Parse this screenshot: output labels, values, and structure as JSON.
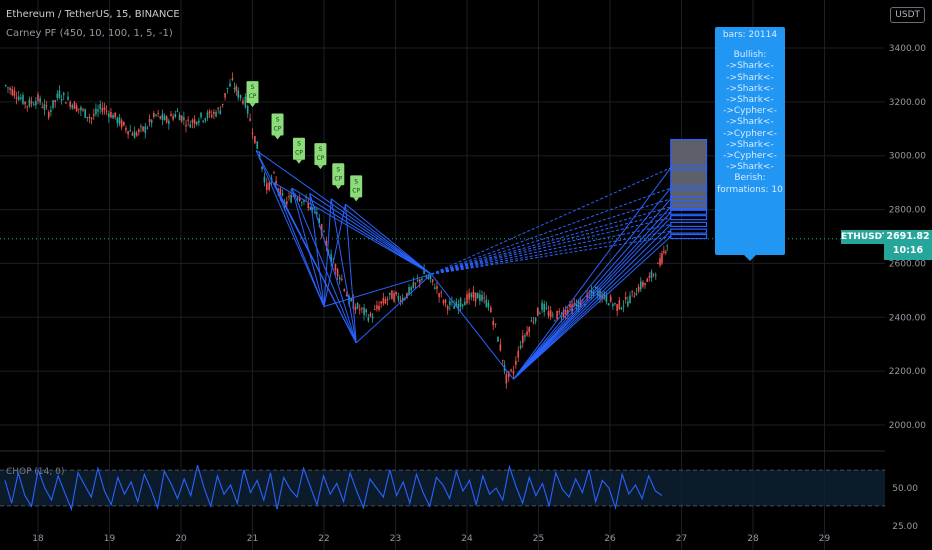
{
  "header": {
    "title": "Ethereum / TetherUS, 15, BINANCE",
    "indicator": "Carney PF (450, 10, 100, 1, 5, -1)",
    "currency": "USDT"
  },
  "colors": {
    "background": "#000000",
    "pattern_lines": "#2962ff",
    "candle_up": "#26a69a",
    "candle_down": "#ef5350",
    "info_box": "#2196f3",
    "price_badge": "#26a69a",
    "signal_label": "#8bdc7a"
  },
  "info_box": {
    "bars": "bars: 20114",
    "lines": [
      "Bullish:",
      "->Shark<-",
      "->Shark<-",
      "->Shark<-",
      "->Shark<-",
      "->Cypher<-",
      "->Shark<-",
      "->Cypher<-",
      "->Shark<-",
      "->Cypher<-",
      "->Shark<-",
      "Berish:",
      "formations: 10"
    ]
  },
  "price_badge": {
    "symbol": "ETHUSDT",
    "price": "2691.82",
    "countdown": "10:16"
  },
  "chop_label": "CHOP (14, 0)",
  "signal_labels": [
    {
      "text": "S\nCP",
      "day": 21.0,
      "price": 3210
    },
    {
      "text": "S\nCP",
      "day": 21.35,
      "price": 3090
    },
    {
      "text": "S\nCP",
      "day": 21.65,
      "price": 3000
    },
    {
      "text": "S\nCP",
      "day": 21.95,
      "price": 2980
    },
    {
      "text": "S\nCP",
      "day": 22.2,
      "price": 2905
    },
    {
      "text": "S\nCP",
      "day": 22.45,
      "price": 2860
    }
  ],
  "chart_data": {
    "type": "line",
    "title": "Ethereum / TetherUS, 15, BINANCE",
    "xlabel": "",
    "ylabel": "",
    "x_ticks": [
      "18",
      "19",
      "20",
      "21",
      "22",
      "23",
      "24",
      "25",
      "26",
      "27",
      "28",
      "29"
    ],
    "x_tick_values": [
      18,
      19,
      20,
      21,
      22,
      23,
      24,
      25,
      26,
      27,
      28,
      29
    ],
    "xlim": [
      17.55,
      30.0
    ],
    "y_ticks": [
      "3400.00",
      "3200.00",
      "3000.00",
      "2800.00",
      "2600.00",
      "2400.00",
      "2200.00",
      "2000.00"
    ],
    "y_tick_values": [
      3400,
      3200,
      3000,
      2800,
      2600,
      2400,
      2200,
      2000
    ],
    "ylim": [
      1915,
      3580
    ],
    "grid": true,
    "series": [
      {
        "points": [
          [
            17.55,
            3260
          ],
          [
            17.7,
            3230
          ],
          [
            17.85,
            3190
          ],
          [
            18.0,
            3210
          ],
          [
            18.15,
            3160
          ],
          [
            18.3,
            3230
          ],
          [
            18.45,
            3200
          ],
          [
            18.6,
            3170
          ],
          [
            18.75,
            3140
          ],
          [
            18.9,
            3180
          ],
          [
            19.05,
            3150
          ],
          [
            19.2,
            3110
          ],
          [
            19.35,
            3080
          ],
          [
            19.5,
            3100
          ],
          [
            19.65,
            3150
          ],
          [
            19.8,
            3130
          ],
          [
            19.95,
            3160
          ],
          [
            20.1,
            3120
          ],
          [
            20.25,
            3140
          ],
          [
            20.4,
            3150
          ],
          [
            20.55,
            3170
          ],
          [
            20.65,
            3250
          ],
          [
            20.72,
            3270
          ],
          [
            20.8,
            3230
          ],
          [
            20.9,
            3200
          ],
          [
            21.0,
            3100
          ],
          [
            21.1,
            3000
          ],
          [
            21.2,
            2880
          ],
          [
            21.3,
            2920
          ],
          [
            21.45,
            2820
          ],
          [
            21.6,
            2860
          ],
          [
            21.75,
            2830
          ],
          [
            21.9,
            2780
          ],
          [
            22.0,
            2700
          ],
          [
            22.1,
            2620
          ],
          [
            22.25,
            2540
          ],
          [
            22.35,
            2460
          ],
          [
            22.5,
            2430
          ],
          [
            22.65,
            2400
          ],
          [
            22.8,
            2450
          ],
          [
            22.95,
            2480
          ],
          [
            23.1,
            2470
          ],
          [
            23.25,
            2510
          ],
          [
            23.4,
            2560
          ],
          [
            23.55,
            2520
          ],
          [
            23.7,
            2450
          ],
          [
            23.85,
            2440
          ],
          [
            24.0,
            2470
          ],
          [
            24.15,
            2480
          ],
          [
            24.3,
            2450
          ],
          [
            24.4,
            2360
          ],
          [
            24.5,
            2250
          ],
          [
            24.55,
            2170
          ],
          [
            24.65,
            2200
          ],
          [
            24.75,
            2300
          ],
          [
            24.9,
            2380
          ],
          [
            25.05,
            2440
          ],
          [
            25.2,
            2400
          ],
          [
            25.35,
            2420
          ],
          [
            25.5,
            2440
          ],
          [
            25.65,
            2460
          ],
          [
            25.8,
            2500
          ],
          [
            25.95,
            2470
          ],
          [
            26.1,
            2440
          ],
          [
            26.25,
            2460
          ],
          [
            26.4,
            2510
          ],
          [
            26.55,
            2540
          ],
          [
            26.7,
            2600
          ],
          [
            26.78,
            2660
          ],
          [
            26.82,
            2690
          ]
        ]
      }
    ],
    "harmonic_points": {
      "X": [
        21.05,
        3020
      ],
      "A1": [
        22.45,
        2305
      ],
      "A2": [
        22.0,
        2440
      ],
      "B": [
        23.5,
        2560
      ],
      "C": [
        24.65,
        2170
      ]
    },
    "projection_zone": {
      "x_range": [
        26.85,
        27.35
      ],
      "price_range": [
        2800,
        3060
      ]
    },
    "projection_levels": [
      2955,
      2880,
      2840,
      2810,
      2790,
      2770,
      2745,
      2720,
      2700
    ],
    "last_price": 2691.82,
    "oscillator": {
      "name": "CHOP (14, 0)",
      "y_ticks": [
        "50.00",
        "25.00"
      ],
      "y_tick_values": [
        50,
        25
      ],
      "ylim": [
        20,
        80
      ],
      "upper_band": 61.8,
      "lower_band": 38.2,
      "values": [
        55,
        40,
        60,
        45,
        38,
        62,
        50,
        42,
        58,
        47,
        36,
        60,
        52,
        44,
        63,
        48,
        39,
        57,
        46,
        54,
        41,
        59,
        49,
        37,
        61,
        53,
        43,
        56,
        45,
        65,
        50,
        38,
        58,
        46,
        52,
        40,
        62,
        47,
        55,
        42,
        60,
        36,
        57,
        49,
        44,
        63,
        51,
        39,
        58,
        46,
        53,
        41,
        60,
        48,
        37,
        56,
        50,
        44,
        62,
        45,
        54,
        40,
        59,
        47,
        38,
        57,
        52,
        43,
        61,
        48,
        55,
        39,
        58,
        46,
        50,
        42,
        64,
        51,
        40,
        57,
        45,
        53,
        38,
        60,
        49,
        44,
        56,
        47,
        62,
        41,
        55,
        50,
        37,
        59,
        46,
        52,
        43,
        58,
        48,
        45
      ]
    }
  }
}
